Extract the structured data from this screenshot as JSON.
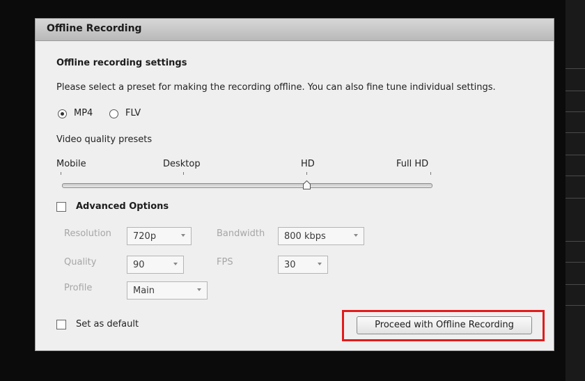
{
  "dialog": {
    "title": "Offline Recording",
    "section_title": "Offline recording settings",
    "description": "Please select a preset for making the recording offline. You can also fine tune individual settings.",
    "format": {
      "options": [
        "MP4",
        "FLV"
      ],
      "selected": "MP4"
    },
    "presets": {
      "label": "Video quality presets",
      "ticks": [
        "Mobile",
        "Desktop",
        "HD",
        "Full HD"
      ],
      "selected": "HD"
    },
    "advanced": {
      "label": "Advanced Options",
      "checked": false,
      "resolution_label": "Resolution",
      "resolution_value": "720p",
      "bandwidth_label": "Bandwidth",
      "bandwidth_value": "800 kbps",
      "quality_label": "Quality",
      "quality_value": "90",
      "fps_label": "FPS",
      "fps_value": "30",
      "profile_label": "Profile",
      "profile_value": "Main"
    },
    "set_default_label": "Set as default",
    "set_default_checked": false,
    "proceed_button": "Proceed with Offline Recording"
  },
  "colors": {
    "highlight": "#e21b1b",
    "dialog_bg": "#efefef",
    "backdrop": "#0b0b0b"
  }
}
